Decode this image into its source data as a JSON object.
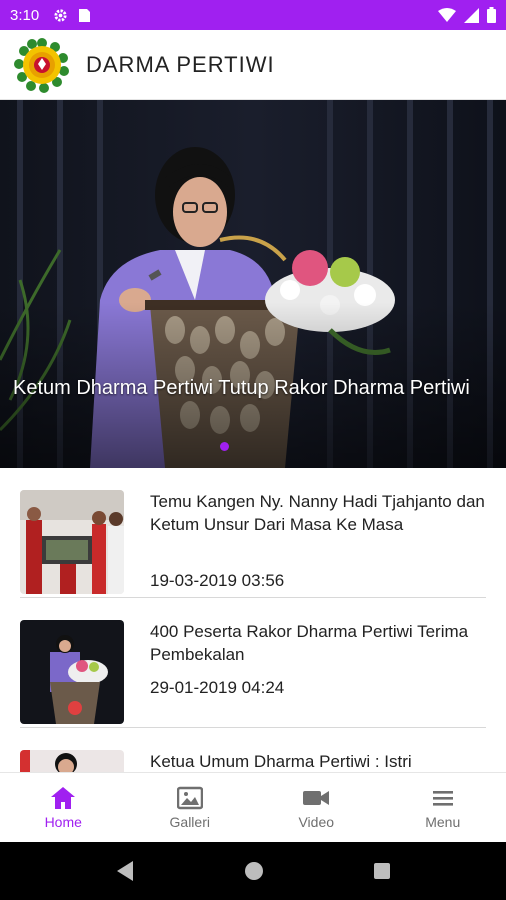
{
  "status_bar": {
    "time": "3:10",
    "left_icons": [
      "gear-icon",
      "sim-card-icon"
    ],
    "right_icons": [
      "wifi-icon",
      "signal-icon",
      "battery-icon"
    ],
    "color": "#a020f0"
  },
  "app_bar": {
    "title": "DARMA PERTIWI",
    "logo_icon": "darma-pertiwi-logo"
  },
  "hero": {
    "caption": "Ketum Dharma Pertiwi Tutup Rakor Dharma Pertiwi",
    "indicator_count": 1,
    "active_index": 0
  },
  "news": [
    {
      "title": "Temu Kangen Ny. Nanny Hadi Tjahjanto dan Ketum Unsur Dari Masa Ke Masa",
      "date": "19-03-2019 03:56"
    },
    {
      "title": "400 Peserta Rakor Dharma Pertiwi Terima Pembekalan",
      "date": "29-01-2019 04:24"
    },
    {
      "title": "Ketua Umum Dharma Pertiwi : Istri",
      "date": ""
    }
  ],
  "bottom_nav": {
    "items": [
      {
        "label": "Home",
        "icon": "home-icon",
        "active": true
      },
      {
        "label": "Galleri",
        "icon": "gallery-icon",
        "active": false
      },
      {
        "label": "Video",
        "icon": "video-camera-icon",
        "active": false
      },
      {
        "label": "Menu",
        "icon": "menu-icon",
        "active": false
      }
    ],
    "active_color": "#a020f0"
  },
  "system_nav": {
    "icons": [
      "back-icon",
      "home-circle-icon",
      "recents-icon"
    ]
  }
}
